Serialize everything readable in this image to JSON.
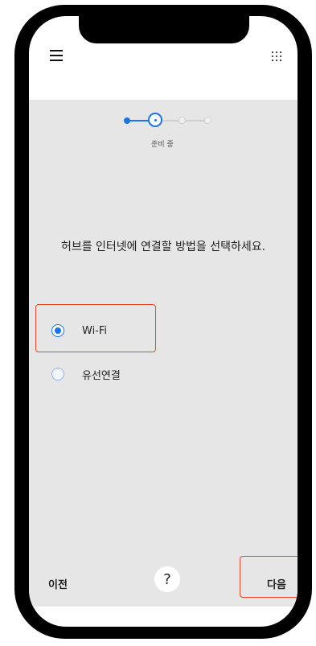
{
  "header": {
    "menu_icon": "menu-icon",
    "apps_icon": "apps-grid-icon"
  },
  "stepper": {
    "current_step": 2,
    "total_steps": 4,
    "label": "준비 중",
    "active_color": "#1a73e8",
    "inactive_color": "#cfcfcf"
  },
  "question": "허브를 인터넷에 연결할 방법을 선택하세요.",
  "options": [
    {
      "label": "Wi-Fi",
      "selected": true
    },
    {
      "label": "유선연결",
      "selected": false
    }
  ],
  "footer": {
    "prev_label": "이전",
    "help_label": "?",
    "next_label": "다음"
  },
  "colors": {
    "accent": "#1a73e8",
    "highlight_box": "#e8472b",
    "content_bg": "#e6e6e6"
  }
}
